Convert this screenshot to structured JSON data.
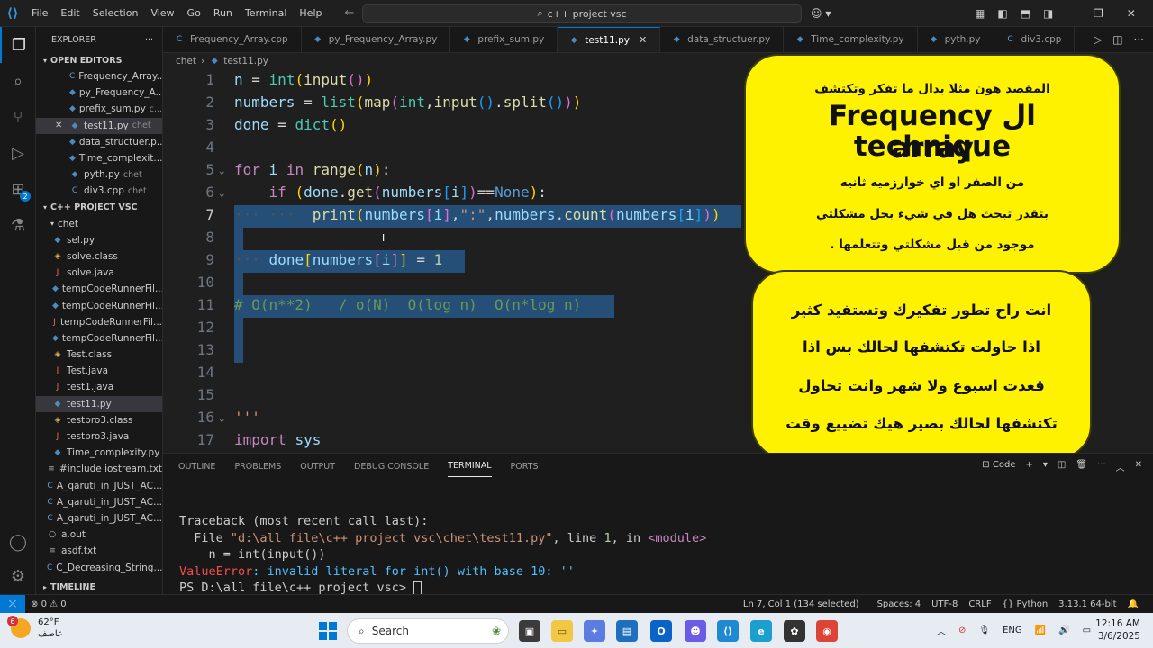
{
  "titlebar": {
    "menu": [
      "File",
      "Edit",
      "Selection",
      "View",
      "Go",
      "Run",
      "Terminal",
      "Help"
    ],
    "search_text": "c++ project vsc"
  },
  "sidebar": {
    "title": "EXPLORER",
    "open_editors_label": "OPEN EDITORS",
    "open_editors": [
      {
        "name": "Frequency_Array...",
        "type": "cpp",
        "desc": ""
      },
      {
        "name": "py_Frequency_A...",
        "type": "py",
        "desc": ""
      },
      {
        "name": "prefix_sum.py",
        "type": "py",
        "desc": "c..."
      },
      {
        "name": "test11.py",
        "type": "py",
        "desc": "chet",
        "selected": true,
        "close": true
      },
      {
        "name": "data_structuer.p...",
        "type": "py",
        "desc": ""
      },
      {
        "name": "Time_complexit...",
        "type": "py",
        "desc": ""
      },
      {
        "name": "pyth.py",
        "type": "py",
        "desc": "chet"
      },
      {
        "name": "div3.cpp",
        "type": "cpp",
        "desc": "chet"
      }
    ],
    "project_label": "C++ PROJECT VSC",
    "folder_label": "chet",
    "folder_files": [
      {
        "name": "sel.py",
        "type": "py"
      },
      {
        "name": "solve.class",
        "type": "class"
      },
      {
        "name": "solve.java",
        "type": "java"
      },
      {
        "name": "tempCodeRunnerFil...",
        "type": "py"
      },
      {
        "name": "tempCodeRunnerFil...",
        "type": "py"
      },
      {
        "name": "tempCodeRunnerFil...",
        "type": "java"
      },
      {
        "name": "tempCodeRunnerFil...",
        "type": "py"
      },
      {
        "name": "Test.class",
        "type": "class"
      },
      {
        "name": "Test.java",
        "type": "java"
      },
      {
        "name": "test1.java",
        "type": "java"
      },
      {
        "name": "test11.py",
        "type": "py",
        "selected": true
      },
      {
        "name": "testpro3.class",
        "type": "class"
      },
      {
        "name": "testpro3.java",
        "type": "java"
      },
      {
        "name": "Time_complexity.py",
        "type": "py"
      }
    ],
    "root_files": [
      {
        "name": "#include iostream.txt",
        "type": "txt"
      },
      {
        "name": "A_qaruti_in_JUST_AC...",
        "type": "cpp"
      },
      {
        "name": "A_qaruti_in_JUST_AC...",
        "type": "cpp"
      },
      {
        "name": "A_qaruti_in_JUST_AC...",
        "type": "cpp"
      },
      {
        "name": "a.out",
        "type": "out"
      },
      {
        "name": "asdf.txt",
        "type": "txt"
      },
      {
        "name": "C_Decreasing_String...",
        "type": "cpp"
      }
    ],
    "timeline_label": "TIMELINE"
  },
  "tabs": [
    {
      "label": "Frequency_Array.cpp",
      "type": "cpp"
    },
    {
      "label": "py_Frequency_Array.py",
      "type": "py"
    },
    {
      "label": "prefix_sum.py",
      "type": "py"
    },
    {
      "label": "test11.py",
      "type": "py",
      "active": true
    },
    {
      "label": "data_structuer.py",
      "type": "py"
    },
    {
      "label": "Time_complexity.py",
      "type": "py"
    },
    {
      "label": "pyth.py",
      "type": "py"
    },
    {
      "label": "div3.cpp",
      "type": "cpp"
    }
  ],
  "breadcrumb": [
    "chet",
    "test11.py"
  ],
  "editor": {
    "line_numbers": [
      "1",
      "2",
      "3",
      "4",
      "5",
      "6",
      "7",
      "8",
      "9",
      "10",
      "11",
      "12",
      "13",
      "14",
      "15",
      "16",
      "17"
    ],
    "current_line": "7",
    "comment_text": "# O(n**2)   / o(N)  O(log n)  O(n*log n)",
    "docstring": "'''",
    "import_kw": "import",
    "import_mod": "sys"
  },
  "overlay": {
    "box1_line1": "المقصد هون مثلا بدال ما تفكر وتكتشف",
    "box1_big1": "Frequency  ال  technique",
    "box1_big2": "array",
    "box1_line2": "من الصفر او اي خوارزميه ثانيه",
    "box1_line3": "بتقدر تبحث هل في شيء بحل مشكلتي",
    "box1_line4": "موجود من قبل مشكلتي وتتعلمها .",
    "box2_line1": "انت راح تطور تفكيرك وتستفيد كثير",
    "box2_line2": "اذا حاولت تكتشفها لحالك بس اذا",
    "box2_line3": "قعدت اسبوع ولا شهر وانت تحاول",
    "box2_line4": "تكتشفها لحالك بصير هيك تضييع وقت"
  },
  "panel": {
    "tabs": [
      "OUTLINE",
      "PROBLEMS",
      "OUTPUT",
      "DEBUG CONSOLE",
      "TERMINAL",
      "PORTS"
    ],
    "active_tab": "TERMINAL",
    "shell_label": "Code",
    "terminal": {
      "line1": "Traceback (most recent call last):",
      "line2_pre": "  File ",
      "line2_file": "\"d:\\all file\\c++ project vsc\\chet\\test11.py\"",
      "line2_mid": ", line ",
      "line2_num": "1",
      "line2_post": ", in ",
      "line2_mod": "<module>",
      "line3": "    n = int(input())",
      "line4_err": "ValueError",
      "line4_msg": ": invalid literal for int() with base 10: ''",
      "prompt": "PS D:\\all file\\c++ project vsc> "
    }
  },
  "statusbar": {
    "errors": "0",
    "warnings": "0",
    "position": "Ln 7, Col 1 (134 selected)",
    "spaces": "Spaces: 4",
    "encoding": "UTF-8",
    "eol": "CRLF",
    "language": "Python",
    "interpreter": "3.13.1 64-bit"
  },
  "taskbar": {
    "weather_badge": "6",
    "temperature": "62°F",
    "weather_text": "عاصف",
    "search_label": "Search",
    "language": "ENG",
    "time": "12:16 AM",
    "date": "3/6/2025"
  }
}
